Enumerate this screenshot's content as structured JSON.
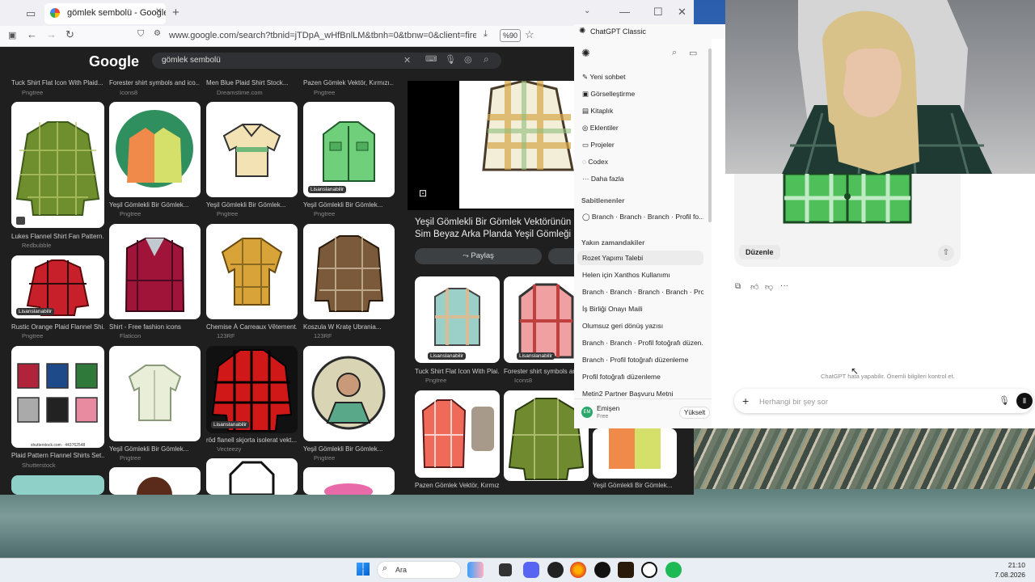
{
  "browser": {
    "tab_title": "gömlek sembolü - Google'da A",
    "url": "www.google.com/search?tbnid=jTDpA_wHfBnlLM&tbnh=0&tbnw=0&client=firefox-b-d&hs=",
    "zoom": "%90"
  },
  "google": {
    "logo": "Google",
    "query": "gömlek sembolü"
  },
  "grid": {
    "top_captions": [
      "Tuck Shirt Flat Icon With Plaid...",
      "Forester shirt symbols and ico...",
      "Men Blue Plaid Shirt Stock...",
      "Pazen Gömlek Vektör, Kırmızı..."
    ],
    "top_sources": [
      "Pngtree",
      "Icons8",
      "Dreamstime.com",
      "Pngtree"
    ],
    "r1": [
      {
        "caption": "Lukes Flannel Shirt Fan Pattern...",
        "source": "Redbubble"
      },
      {
        "caption": "Yeşil Gömlekli Bir Gömlek...",
        "source": "Pngtree"
      },
      {
        "caption": "Yeşil Gömlekli Bir Gömlek...",
        "source": "Pngtree"
      },
      {
        "caption": "Yeşil Gömlekli Bir Gömlek...",
        "source": "Pngtree"
      }
    ],
    "r2": [
      {
        "caption": "Rustic Orange Plaid Flannel Shi...",
        "source": "Pngtree"
      },
      {
        "caption": "Shirt - Free fashion icons",
        "source": "Flaticon"
      },
      {
        "caption": "Chemise À Carreaux Vêtement...",
        "source": "123RF"
      },
      {
        "caption": "Koszula W Kratę Ubrania...",
        "source": "123RF"
      }
    ],
    "r3": [
      {
        "caption": "Plaid Pattern Flannel Shirts Set...",
        "source": "Shutterstock"
      },
      {
        "caption": "Yeşil Gömlekli Bir Gömlek...",
        "source": "Pngtree"
      },
      {
        "caption": "röd flanell skjorta isolerat vekt...",
        "source": "Vecteezy"
      },
      {
        "caption": "Yeşil Gömlekli Bir Gömlek...",
        "source": "Pngtree"
      }
    ],
    "licensed": "Lisanslanabilir",
    "watermark": "shutterstock.com · 443762548"
  },
  "preview": {
    "title": "Yeşil Gömlekli Bir Gömlek Vektörünün Sim Beyaz Arka Planda Yeşil Gömleği Tasvir Ed",
    "share": "Paylaş",
    "related": [
      {
        "caption": "Tuck Shirt Flat Icon With Plai...",
        "source": "Pngtree"
      },
      {
        "caption": "Forester shirt symbols and...",
        "source": "Icons8"
      }
    ],
    "bottom_captions": [
      "Pazen Gömlek Vektör, Kırmız...",
      "Yeşil Gömlekli Bir Gömlek..."
    ]
  },
  "chatgpt": {
    "window_title": "ChatGPT Classic",
    "menu": [
      "Yeni sohbet",
      "Görselleştirme",
      "Kitaplık",
      "Eklentiler",
      "Projeler",
      "Codex",
      "Daha fazla"
    ],
    "pinned_title": "Sabitlenenler",
    "pinned": [
      "Branch · Branch · Branch · Profil fo..."
    ],
    "recent_title": "Yakın zamandakiler",
    "recent": [
      "Rozet Yapımı Talebi",
      "Helen için Xanthos Kullanımı",
      "Branch · Branch · Branch · Branch · Prof...",
      "İş Birliği Onayı Maili",
      "Olumsuz geri dönüş yazısı",
      "Branch · Branch · Profil fotoğrafı düzen...",
      "Branch · Profil fotoğrafı düzenleme",
      "Profil fotoğrafı düzenleme",
      "Metin2 Partner Başvuru Metni"
    ],
    "user_name": "Emişen",
    "user_plan": "Free",
    "avatar": "EM",
    "upgrade": "Yükselt",
    "edit_btn": "Düzenle",
    "disclaimer": "ChatGPT hata yapabilir. Önemli bilgileri kontrol et.",
    "input_placeholder": "Herhangi bir şey sor"
  },
  "taskbar": {
    "search": "Ara",
    "time": "21:10",
    "date": "7.08.2026"
  },
  "colors": {
    "accent": "#3b82f6",
    "google_dark": "#1f1f1f",
    "plaid_green": "#5a8a2f"
  }
}
